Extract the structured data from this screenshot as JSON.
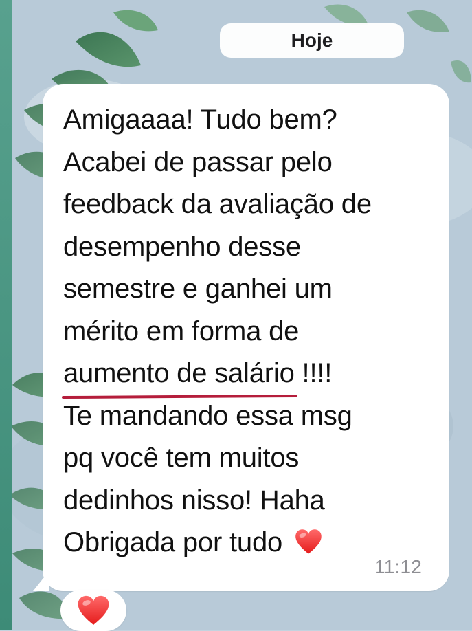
{
  "header": {
    "date_label": "Hoje"
  },
  "message": {
    "lines": [
      "Amigaaaa! Tudo bem?",
      "Acabei de passar pelo",
      "feedback da avaliação de",
      "desempenho desse",
      "semestre e ganhei um",
      "mérito em forma de"
    ],
    "underlined": "aumento de salário",
    "after_underline": " !!!!",
    "lines_after": [
      "Te mandando essa msg",
      "pq você tem muitos",
      "dedinhos nisso! Haha"
    ],
    "last_line": "Obrigada por tudo",
    "heart_icon": "red-heart-emoji",
    "timestamp": "11:12"
  },
  "reaction": {
    "icon": "red-heart-emoji"
  },
  "colors": {
    "underline": "#b51d3b",
    "timestamp": "#8e8e93",
    "text": "#111111"
  }
}
